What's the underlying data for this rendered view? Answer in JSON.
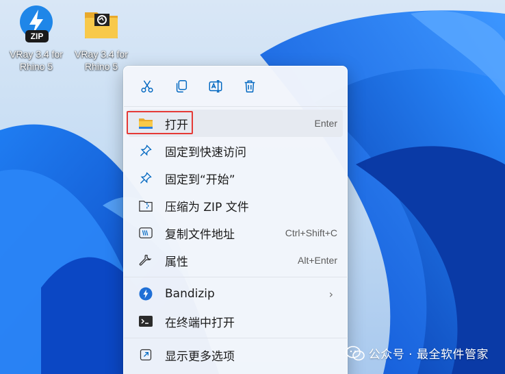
{
  "desktop": {
    "icons": [
      {
        "label": "VRay 3.4 for Rhino 5",
        "type": "zip",
        "badge": "ZIP"
      },
      {
        "label": "VRay 3.4 for Rhino 5",
        "type": "folder"
      }
    ]
  },
  "context_menu": {
    "quick_actions": [
      "cut-icon",
      "copy-icon",
      "rename-icon",
      "delete-icon"
    ],
    "items": [
      {
        "label": "打开",
        "shortcut": "Enter",
        "icon": "folder-icon"
      },
      {
        "label": "固定到快速访问",
        "icon": "pin-icon"
      },
      {
        "label": "固定到“开始”",
        "icon": "pin-icon"
      },
      {
        "label": "压缩为 ZIP 文件",
        "icon": "zip-folder-icon"
      },
      {
        "label": "复制文件地址",
        "shortcut": "Ctrl+Shift+C",
        "icon": "path-icon"
      },
      {
        "label": "属性",
        "shortcut": "Alt+Enter",
        "icon": "wrench-icon"
      },
      {
        "label": "Bandizip",
        "icon": "bandizip-icon",
        "submenu": true
      },
      {
        "label": "在终端中打开",
        "icon": "terminal-icon"
      },
      {
        "label": "显示更多选项",
        "icon": "more-options-icon"
      }
    ]
  },
  "watermark": {
    "text": "公众号 · 最全软件管家"
  },
  "colors": {
    "wallpaper": "#0a5bd8",
    "highlight": "#e53935",
    "accent": "#0067c0"
  }
}
